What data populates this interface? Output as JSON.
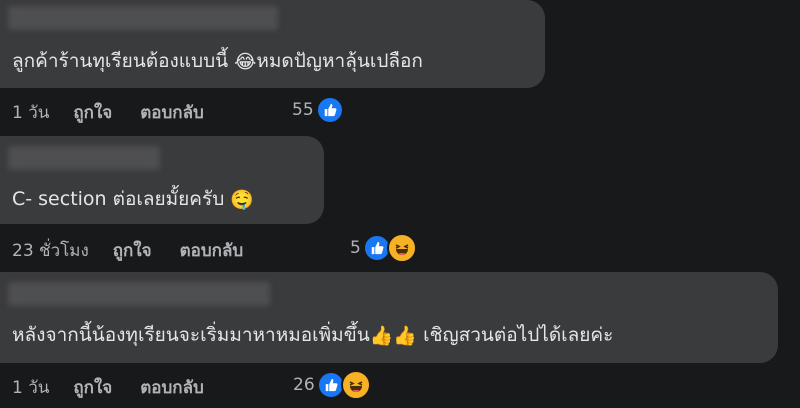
{
  "comments": [
    {
      "text_before": "ลูกค้าร้านทุเรียนต้องแบบนี้ ",
      "emoji": "😂",
      "text_after": "หมดปัญหาลุ้นเปลือก",
      "time": "1 วัน",
      "like": "ถูกใจ",
      "reply": "ตอบกลับ",
      "reaction_count": "55",
      "reactions": [
        "like-icon"
      ]
    },
    {
      "text_before": "C- section ต่อเลยมั้ยครับ ",
      "emoji": "🤤",
      "text_after": "",
      "time": "23 ชั่วโมง",
      "like": "ถูกใจ",
      "reply": "ตอบกลับ",
      "reaction_count": "5",
      "reactions": [
        "like-icon",
        "haha-icon"
      ]
    },
    {
      "text_before": "หลังจากนี้น้องทุเรียนจะเริ่มมาหาหมอเพิ่มขึ้น",
      "emoji": "👍👍",
      "text_after": " เชิญสวนต่อไปได้เลยค่ะ",
      "time": "1 วัน",
      "like": "ถูกใจ",
      "reply": "ตอบกลับ",
      "reaction_count": "26",
      "reactions": [
        "like-icon",
        "haha-icon"
      ]
    }
  ],
  "colors": {
    "background": "#18191a",
    "bubble": "#3a3b3c",
    "text": "#e4e6eb",
    "secondary_text": "#b0b3b8",
    "like_blue": "#1877f2",
    "haha_yellow": "#f7b125"
  }
}
